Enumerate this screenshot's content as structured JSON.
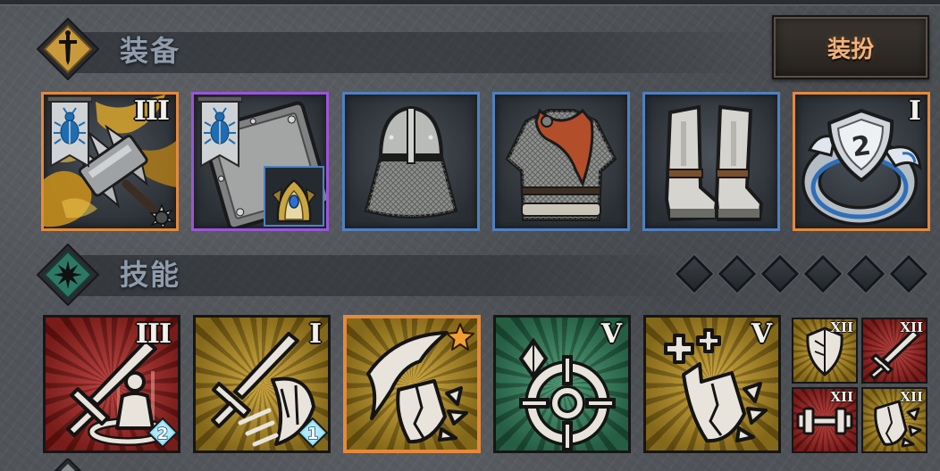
{
  "equipment": {
    "title": "装备",
    "header_icon": "sword-icon",
    "dress_up_button": "装扮",
    "slots": [
      {
        "icon": "spiked-mace-icon",
        "tier": "III",
        "banner_icon": "blue-beetle-icon",
        "border_color": "#e5893a"
      },
      {
        "icon": "iron-shield-icon",
        "banner_icon": "blue-beetle-icon",
        "inset_icon": "gold-armor-icon",
        "border_color": "#9b55d8"
      },
      {
        "icon": "helmet-icon",
        "border_color": "#4f80c2"
      },
      {
        "icon": "chainmail-armor-icon",
        "border_color": "#4f80c2"
      },
      {
        "icon": "boots-icon",
        "border_color": "#4f80c2"
      },
      {
        "icon": "emblem-ring-icon",
        "tier": "I",
        "emblem_number": "2",
        "border_color": "#e5893a"
      }
    ]
  },
  "skills": {
    "title": "技能",
    "header_icon": "star-icon",
    "skill_points": [
      "diamond-slot-icon",
      "diamond-slot-icon",
      "diamond-slot-icon",
      "diamond-slot-icon",
      "diamond-slot-icon",
      "diamond-slot-icon"
    ],
    "main": [
      {
        "icon": "sword-guardian-icon",
        "tier": "III",
        "level_badge": "2",
        "bg_color": "#b3201c"
      },
      {
        "icon": "sword-shield-strike-icon",
        "tier": "I",
        "level_badge": "1",
        "bg_color": "#c79a1c"
      },
      {
        "icon": "claw-shield-break-icon",
        "starred": true,
        "bg_color": "#c79a1c",
        "border_color": "#e5893a"
      },
      {
        "icon": "crosshair-crystal-icon",
        "tier": "V",
        "bg_color": "#2f8a5e"
      },
      {
        "icon": "heal-shield-break-icon",
        "tier": "V",
        "bg_color": "#c79a1c"
      }
    ],
    "passive": [
      {
        "icon": "shield-icon",
        "tier": "XII",
        "bg_color": "#c79a1c"
      },
      {
        "icon": "sword-icon",
        "tier": "XII",
        "bg_color": "#b3201c"
      },
      {
        "icon": "dumbbell-icon",
        "tier": "XII",
        "bg_color": "#b3201c"
      },
      {
        "icon": "shield-break-icon",
        "tier": "XII",
        "bg_color": "#c79a1c"
      }
    ]
  }
}
